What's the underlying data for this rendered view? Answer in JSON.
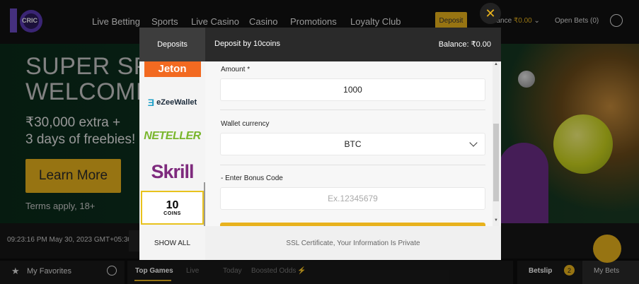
{
  "nav": {
    "logo_text": "CRIC",
    "items": [
      "Live Betting",
      "Sports",
      "Live Casino",
      "Casino",
      "Promotions",
      "Loyalty Club"
    ],
    "deposit_label": "Deposit",
    "balance_label": "Balance",
    "balance_value": "₹0.00",
    "open_bets": "Open Bets (0)"
  },
  "hero": {
    "title_line1": "SUPER SPO",
    "title_line2": "WELCOME",
    "sub_line1": "₹30,000 extra +",
    "sub_line2": "3 days of freebies!",
    "cta": "Learn More",
    "terms": "Terms apply, 18+"
  },
  "clock": "09:23:16 PM May 30, 2023 GMT+05:30",
  "favorites_label": "My Favorites",
  "tabs": [
    "Top Games",
    "Live",
    "Today",
    "Boosted Odds"
  ],
  "betslip": {
    "label": "Betslip",
    "count": "2",
    "mybets": "My Bets"
  },
  "modal": {
    "tab": "Deposits",
    "title": "Deposit by 10coins",
    "balance": "Balance: ₹0.00",
    "methods": {
      "jeton": "Jeton",
      "ezee": "eZeeWallet",
      "neteller": "NETELLER",
      "skrill": "Skrill",
      "tencoins_top": "10",
      "tencoins_bottom": "COINS"
    },
    "show_all": "SHOW ALL",
    "form": {
      "amount_label": "Amount *",
      "amount_value": "1000",
      "currency_label": "Wallet currency",
      "currency_value": "BTC",
      "bonus_label": "- Enter Bonus Code",
      "bonus_placeholder": "Ex.12345679"
    },
    "ssl_text": "SSL Certificate, Your Information Is Private",
    "close_glyph": "✕"
  },
  "colors": {
    "accent": "#e8b21d",
    "header_bg": "#2a2a2a",
    "skrill": "#7e2a7d",
    "neteller": "#79b62c",
    "jeton": "#f26a21"
  }
}
